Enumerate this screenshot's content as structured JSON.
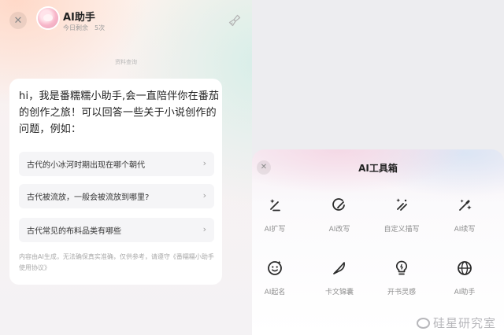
{
  "chat": {
    "assistant_name": "AI助手",
    "quota_label": "今日剩余",
    "quota_value": "5次",
    "close_glyph": "✕",
    "divider_text": "资料查询",
    "greeting": "hi，我是番糯糯小助手,会一直陪伴你在番茄的创作之旅！可以回答一些关于小说创作的问题，例如：",
    "questions": [
      "古代的小冰河时期出现在哪个朝代",
      "古代被流放，一般会被流放到哪里?",
      "古代常见的布料品类有哪些"
    ],
    "chevron_glyph": "›",
    "disclaimer": "内容由AI生成，无法确保真实准确，仅供参考，请遵守《番糯糯小助手使用协议》"
  },
  "toolbox": {
    "title": "AI工具箱",
    "close_glyph": "✕",
    "tools": [
      {
        "label": "AI扩写",
        "icon": "expand-write-icon"
      },
      {
        "label": "AI改写",
        "icon": "rewrite-icon"
      },
      {
        "label": "自定义描写",
        "icon": "custom-describe-icon"
      },
      {
        "label": "AI续写",
        "icon": "continue-write-icon"
      },
      {
        "label": "AI起名",
        "icon": "naming-icon"
      },
      {
        "label": "卡文锦囊",
        "icon": "writer-block-tips-icon"
      },
      {
        "label": "开书灵感",
        "icon": "inspiration-icon"
      },
      {
        "label": "AI助手",
        "icon": "ai-assistant-icon"
      }
    ]
  },
  "watermark": "硅星研究室",
  "colors": {
    "text": "#222222",
    "muted": "#8d8d8d",
    "card": "#ffffff",
    "question_bg": "#f5f5f7"
  }
}
